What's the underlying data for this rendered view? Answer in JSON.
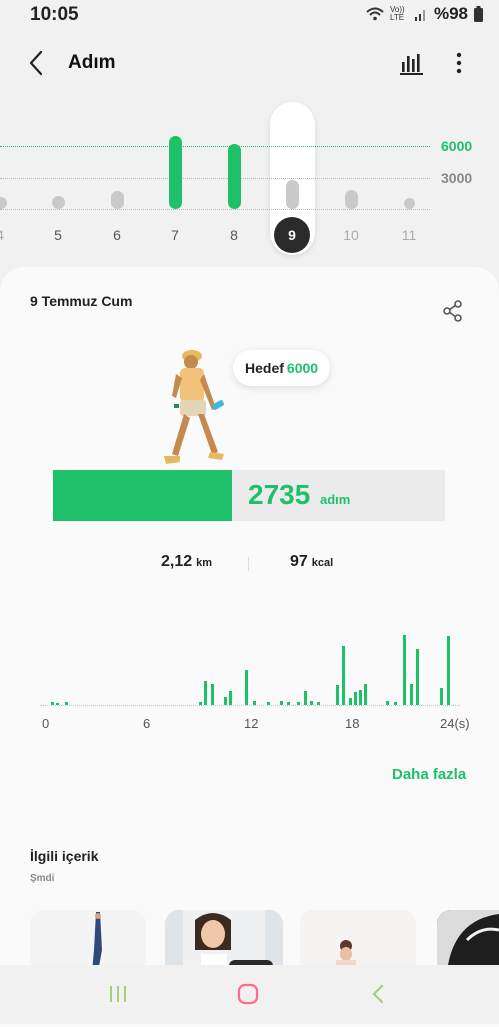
{
  "status": {
    "time": "10:05",
    "volte": "Vo)) LTE",
    "battery": "%98"
  },
  "app": {
    "title": "Adım"
  },
  "week": {
    "goal_line_label": "6000",
    "mid_line_label": "3000",
    "days": [
      {
        "label": "4",
        "steps": 1000
      },
      {
        "label": "5",
        "steps": 1200
      },
      {
        "label": "6",
        "steps": 1700
      },
      {
        "label": "7",
        "steps": 7000
      },
      {
        "label": "8",
        "steps": 6200
      },
      {
        "label": "9",
        "steps": 2735
      },
      {
        "label": "10",
        "steps": 1800
      },
      {
        "label": "11",
        "steps": 400
      }
    ],
    "selected": "9"
  },
  "detail": {
    "date": "9 Temmuz Cum",
    "goal_label": "Hedef",
    "goal_value": "6000",
    "steps": "2735",
    "steps_unit": "adım",
    "goal_progress": 0.456,
    "distance": "2,12",
    "distance_unit": "km",
    "calories": "97",
    "calories_unit": "kcal"
  },
  "chart_data": {
    "type": "bar",
    "x_ticks": [
      "0",
      "6",
      "12",
      "18",
      "24(s)"
    ],
    "values": [
      5,
      3,
      4,
      0,
      0,
      0,
      0,
      0,
      0,
      0,
      0,
      0,
      0,
      0,
      0,
      0,
      0,
      0,
      0,
      0,
      0,
      0,
      0,
      0,
      0,
      0,
      0,
      0,
      0,
      0,
      0,
      0,
      0,
      0,
      0,
      0,
      0,
      0,
      0,
      0,
      0,
      0,
      0,
      0,
      0,
      0,
      0,
      0,
      0,
      0,
      0,
      0,
      0,
      0,
      4,
      35,
      30,
      0,
      0,
      0,
      0,
      25,
      18,
      0,
      0,
      0,
      0,
      0,
      0,
      0,
      0,
      0,
      50,
      6,
      0,
      0,
      0,
      4,
      0,
      0,
      0,
      0,
      0,
      0,
      0,
      6,
      0,
      5,
      0,
      0,
      0,
      5,
      0,
      6,
      0,
      4,
      0,
      0,
      0,
      0,
      20,
      0,
      0,
      0,
      0,
      0,
      4,
      0,
      0,
      0,
      0,
      0,
      0,
      0,
      0,
      0,
      0,
      0,
      0,
      0,
      0,
      0,
      0,
      0,
      0,
      0,
      0,
      0,
      0,
      0,
      0,
      0,
      0,
      0,
      0,
      0,
      0,
      0,
      0,
      0,
      0,
      0,
      0,
      0,
      0,
      0,
      0,
      0,
      0,
      0,
      0,
      0,
      0,
      0
    ],
    "highlights": [
      {
        "hour": 0.3,
        "v": 5
      },
      {
        "hour": 0.6,
        "v": 3
      },
      {
        "hour": 1.1,
        "v": 4
      },
      {
        "hour": 9.1,
        "v": 4
      },
      {
        "hour": 9.4,
        "v": 35
      },
      {
        "hour": 9.8,
        "v": 30
      },
      {
        "hour": 10.6,
        "v": 12
      },
      {
        "hour": 10.9,
        "v": 20
      },
      {
        "hour": 11.8,
        "v": 50
      },
      {
        "hour": 12.3,
        "v": 6
      },
      {
        "hour": 13.1,
        "v": 4
      },
      {
        "hour": 13.9,
        "v": 6
      },
      {
        "hour": 14.3,
        "v": 5
      },
      {
        "hour": 14.9,
        "v": 5
      },
      {
        "hour": 15.3,
        "v": 20
      },
      {
        "hour": 15.7,
        "v": 6
      },
      {
        "hour": 16.1,
        "v": 4
      },
      {
        "hour": 17.2,
        "v": 28
      },
      {
        "hour": 17.6,
        "v": 85
      },
      {
        "hour": 18.0,
        "v": 10
      },
      {
        "hour": 18.3,
        "v": 18
      },
      {
        "hour": 18.6,
        "v": 22
      },
      {
        "hour": 18.9,
        "v": 30
      },
      {
        "hour": 20.2,
        "v": 6
      },
      {
        "hour": 20.7,
        "v": 4
      },
      {
        "hour": 21.2,
        "v": 100
      },
      {
        "hour": 21.6,
        "v": 30
      },
      {
        "hour": 22.0,
        "v": 80
      },
      {
        "hour": 23.4,
        "v": 25
      },
      {
        "hour": 23.8,
        "v": 98
      }
    ],
    "xlim": [
      0,
      24
    ]
  },
  "more_link": "Daha fazla",
  "related": {
    "title": "İlgili içerik",
    "subtitle": "Şmdi"
  },
  "colors": {
    "accent": "#1ec06a",
    "bar_inactive": "#c9c9c9"
  }
}
